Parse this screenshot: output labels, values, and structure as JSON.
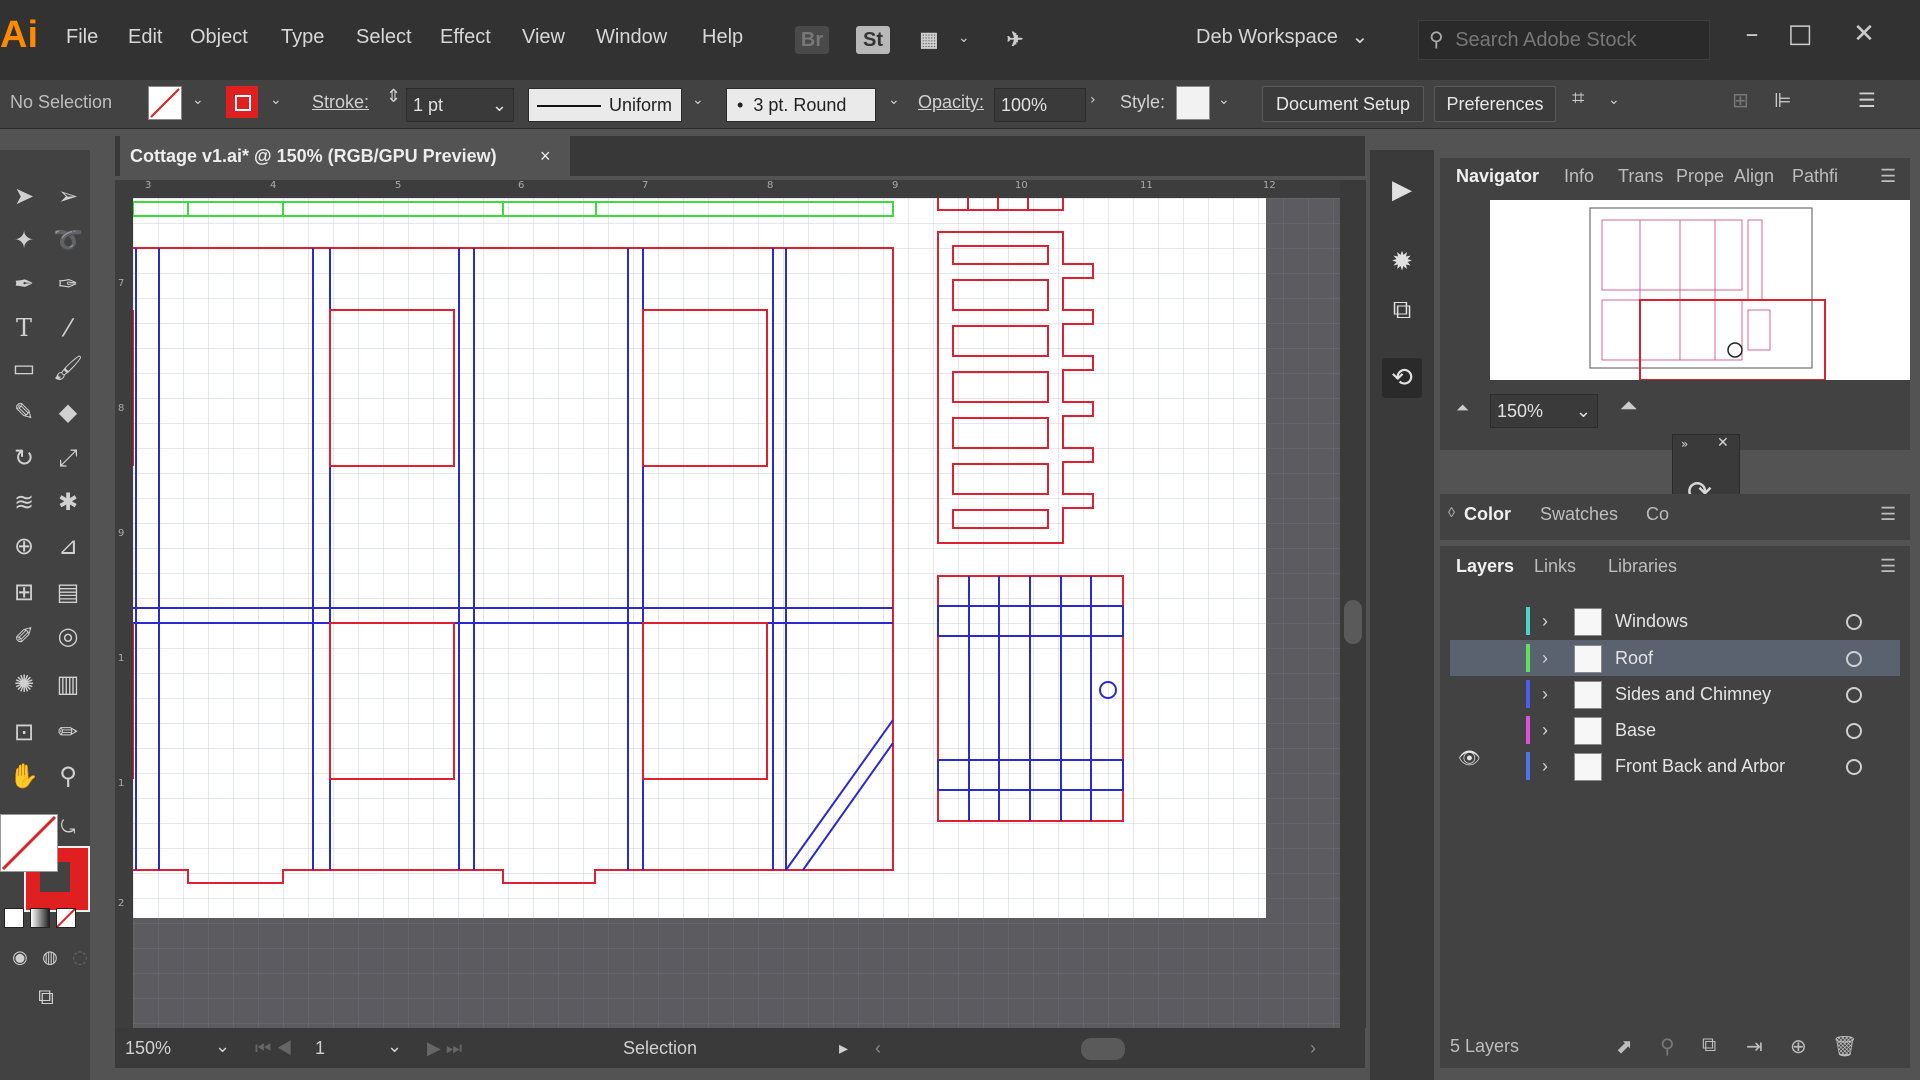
{
  "app": {
    "logo": "Ai",
    "accent": "#ff8a00"
  },
  "menu": [
    "File",
    "Edit",
    "Object",
    "Type",
    "Select",
    "Effect",
    "View",
    "Window",
    "Help"
  ],
  "top_icons": {
    "br": "Br",
    "st": "St"
  },
  "workspace": "Deb Workspace",
  "search_placeholder": "Search Adobe Stock",
  "control": {
    "selection": "No Selection",
    "stroke_label": "Stroke:",
    "stroke_weight": "1 pt",
    "profile": "Uniform",
    "brush": "3 pt. Round",
    "opacity_label": "Opacity:",
    "opacity": "100%",
    "style_label": "Style:",
    "document_setup": "Document Setup",
    "preferences": "Preferences"
  },
  "document": {
    "tab_title": "Cottage v1.ai* @ 150% (RGB/GPU Preview)",
    "close": "×"
  },
  "ruler_top": [
    "3",
    "4",
    "5",
    "6",
    "7",
    "8",
    "9",
    "10",
    "11",
    "12"
  ],
  "ruler_left": [
    "7",
    "8",
    "9",
    "1",
    "1",
    "2"
  ],
  "status": {
    "zoom": "150%",
    "artboard": "1",
    "mode": "Selection"
  },
  "navigator": {
    "tabs": [
      "Navigator",
      "Info",
      "Trans",
      "Prope",
      "Align",
      "Pathfi"
    ],
    "zoom": "150%"
  },
  "color_panel": {
    "tabs": [
      "Color",
      "Swatches",
      "Co"
    ]
  },
  "layers_panel": {
    "tabs": [
      "Layers",
      "Links",
      "Libraries"
    ],
    "layers": [
      {
        "name": "Windows",
        "color": "#4dd2c8",
        "visible": false,
        "selected": false
      },
      {
        "name": "Roof",
        "color": "#5fe05f",
        "visible": false,
        "selected": true
      },
      {
        "name": "Sides and Chimney",
        "color": "#4f5cf0",
        "visible": false,
        "selected": false
      },
      {
        "name": "Base",
        "color": "#e04fe0",
        "visible": false,
        "selected": false
      },
      {
        "name": "Front Back and Arbor",
        "color": "#4f74f0",
        "visible": true,
        "selected": false
      }
    ],
    "count": "5 Layers"
  }
}
